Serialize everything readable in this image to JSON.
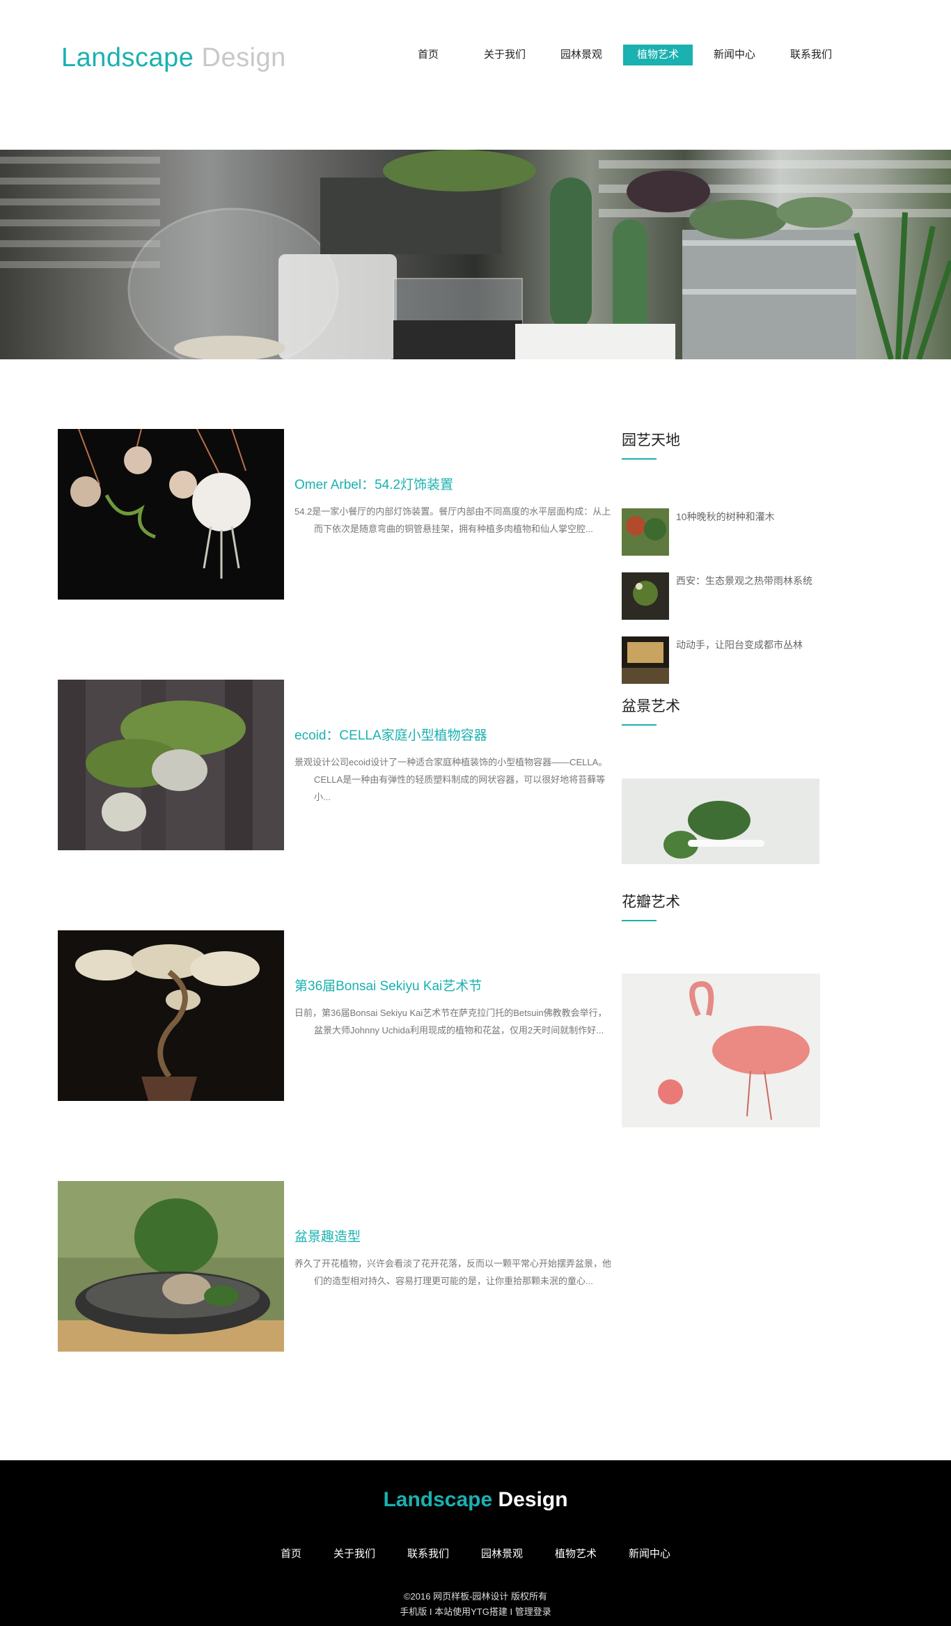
{
  "header": {
    "logo_part1": "Landscape",
    "logo_part2": "Design",
    "nav": [
      "首页",
      "关于我们",
      "园林景观",
      "植物艺术",
      "新闻中心",
      "联系我们"
    ],
    "active_index": 3
  },
  "posts": [
    {
      "title": "Omer Arbel：54.2灯饰装置",
      "excerpt": "54.2是一家小餐厅的内部灯饰装置。餐厅内部由不同高度的水平层面构成：从上而下依次是随意弯曲的铜管悬挂架，拥有种植多肉植物和仙人掌空腔..."
    },
    {
      "title": "ecoid：CELLA家庭小型植物容器",
      "excerpt": "景观设计公司ecoid设计了一种适合家庭种植装饰的小型植物容器——CELLA。CELLA是一种由有弹性的轻质塑料制成的网状容器，可以很好地将苔藓等小..."
    },
    {
      "title": "第36届Bonsai Sekiyu Kai艺术节",
      "excerpt": "日前，第36届Bonsai Sekiyu Kai艺术节在萨克拉门托的Betsuin佛教教会举行，盆景大师Johnny Uchida利用现成的植物和花盆，仅用2天时间就制作好..."
    },
    {
      "title": "盆景趣造型",
      "excerpt": "养久了开花植物，兴许会看淡了花开花落，反而以一颗平常心开始摆弄盆景，他们的造型相对持久、容易打理更可能的是，让你重拾那颗未泯的童心..."
    }
  ],
  "sidebar": {
    "section1_title": "园艺天地",
    "section1_items": [
      "10种晚秋的树种和灌木",
      "西安：生态景观之热带雨林系统",
      "动动手，让阳台变成都市丛林"
    ],
    "section2_title": "盆景艺术",
    "section3_title": "花瓣艺术"
  },
  "footer": {
    "logo_part1": "Landscape",
    "logo_part2": "Design",
    "nav": [
      "首页",
      "关于我们",
      "联系我们",
      "园林景观",
      "植物艺术",
      "新闻中心"
    ],
    "copyright": "©2016 网页样板-园林设计 版权所有",
    "link1": "手机版",
    "link2": "本站使用YTG搭建",
    "link3": "管理登录",
    "sep": " I "
  }
}
